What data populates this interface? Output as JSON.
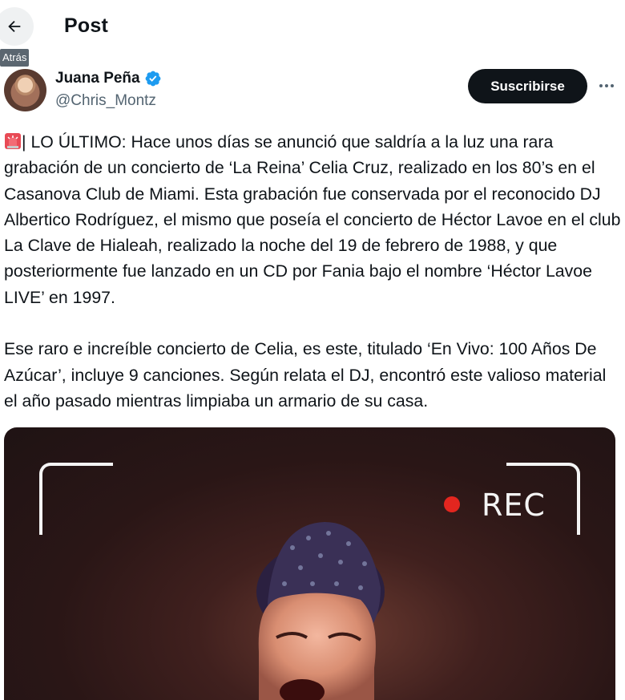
{
  "header": {
    "title": "Post",
    "back_tooltip": "Atrás"
  },
  "author": {
    "name": "Juana Peña",
    "handle": "@Chris_Montz",
    "verified": true,
    "verified_color": "#1d9bf0"
  },
  "actions": {
    "subscribe_label": "Suscribirse"
  },
  "post": {
    "emoji": "rotating-light",
    "text": "| LO ÚLTIMO: Hace unos días se anunció que saldría a la luz una rara grabación de un concierto de ‘La Reina’ Celia Cruz, realizado en los 80’s en el Casanova Club de Miami. Esta grabación fue conservada por el reconocido DJ Albertico Rodríguez, el mismo que poseía el concierto de Héctor Lavoe en el club La Clave de Hialeah, realizado la noche del 19 de febrero de 1988, y que posteriormente fue lanzado en un CD por Fania bajo el nombre ‘Héctor Lavoe LIVE’ en 1997.\n\nEse raro e increíble concierto de Celia, es este, titulado ‘En Vivo: 100 Años De Azúcar’, incluye 9 canciones. Según relata el DJ, encontró este valioso material el año pasado mientras limpiaba un armario de su casa."
  },
  "media": {
    "overlay_label": "REC",
    "rec_color": "#e3261f"
  }
}
